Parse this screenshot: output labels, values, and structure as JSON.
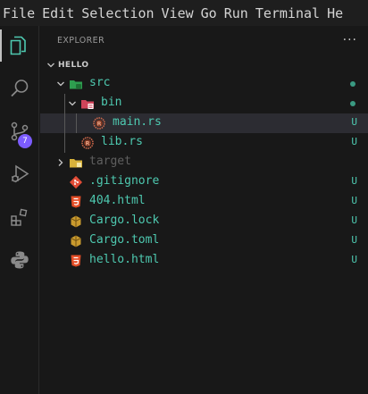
{
  "menu": [
    "File",
    "Edit",
    "Selection",
    "View",
    "Go",
    "Run",
    "Terminal",
    "He"
  ],
  "activity_bar": {
    "items": [
      {
        "icon": "explorer-icon"
      },
      {
        "icon": "search-icon"
      },
      {
        "icon": "source-control-icon",
        "badge": "7"
      },
      {
        "icon": "run-debug-icon"
      },
      {
        "icon": "extensions-icon"
      },
      {
        "icon": "python-icon"
      }
    ]
  },
  "explorer": {
    "title": "EXPLORER",
    "more": "···",
    "section": "HELLO",
    "items": [
      {
        "label": "src",
        "status": "dot",
        "color": "#4ec9b0",
        "icon": "folder-src-icon",
        "expanded": true
      },
      {
        "label": "bin",
        "status": "dot",
        "color": "#4ec9b0",
        "icon": "folder-bin-icon",
        "expanded": true
      },
      {
        "label": "main.rs",
        "status": "U",
        "color": "#4ec9b0",
        "icon": "rust-file-icon"
      },
      {
        "label": "lib.rs",
        "status": "U",
        "color": "#4ec9b0",
        "icon": "rust-file-icon"
      },
      {
        "label": "target",
        "status": "",
        "color": "#5f5f5f",
        "icon": "folder-target-icon",
        "expanded": false
      },
      {
        "label": ".gitignore",
        "status": "U",
        "color": "#4ec9b0",
        "icon": "git-file-icon"
      },
      {
        "label": "404.html",
        "status": "U",
        "color": "#4ec9b0",
        "icon": "html-file-icon"
      },
      {
        "label": "Cargo.lock",
        "status": "U",
        "color": "#4ec9b0",
        "icon": "cargo-file-icon"
      },
      {
        "label": "Cargo.toml",
        "status": "U",
        "color": "#4ec9b0",
        "icon": "cargo-file-icon"
      },
      {
        "label": "hello.html",
        "status": "U",
        "color": "#4ec9b0",
        "icon": "html-file-icon"
      }
    ]
  },
  "colors": {
    "untracked": "#4ec9b0",
    "ignored": "#5f5f5f",
    "accent_badge": "#7c5cff",
    "selection": "#2c2c32"
  }
}
